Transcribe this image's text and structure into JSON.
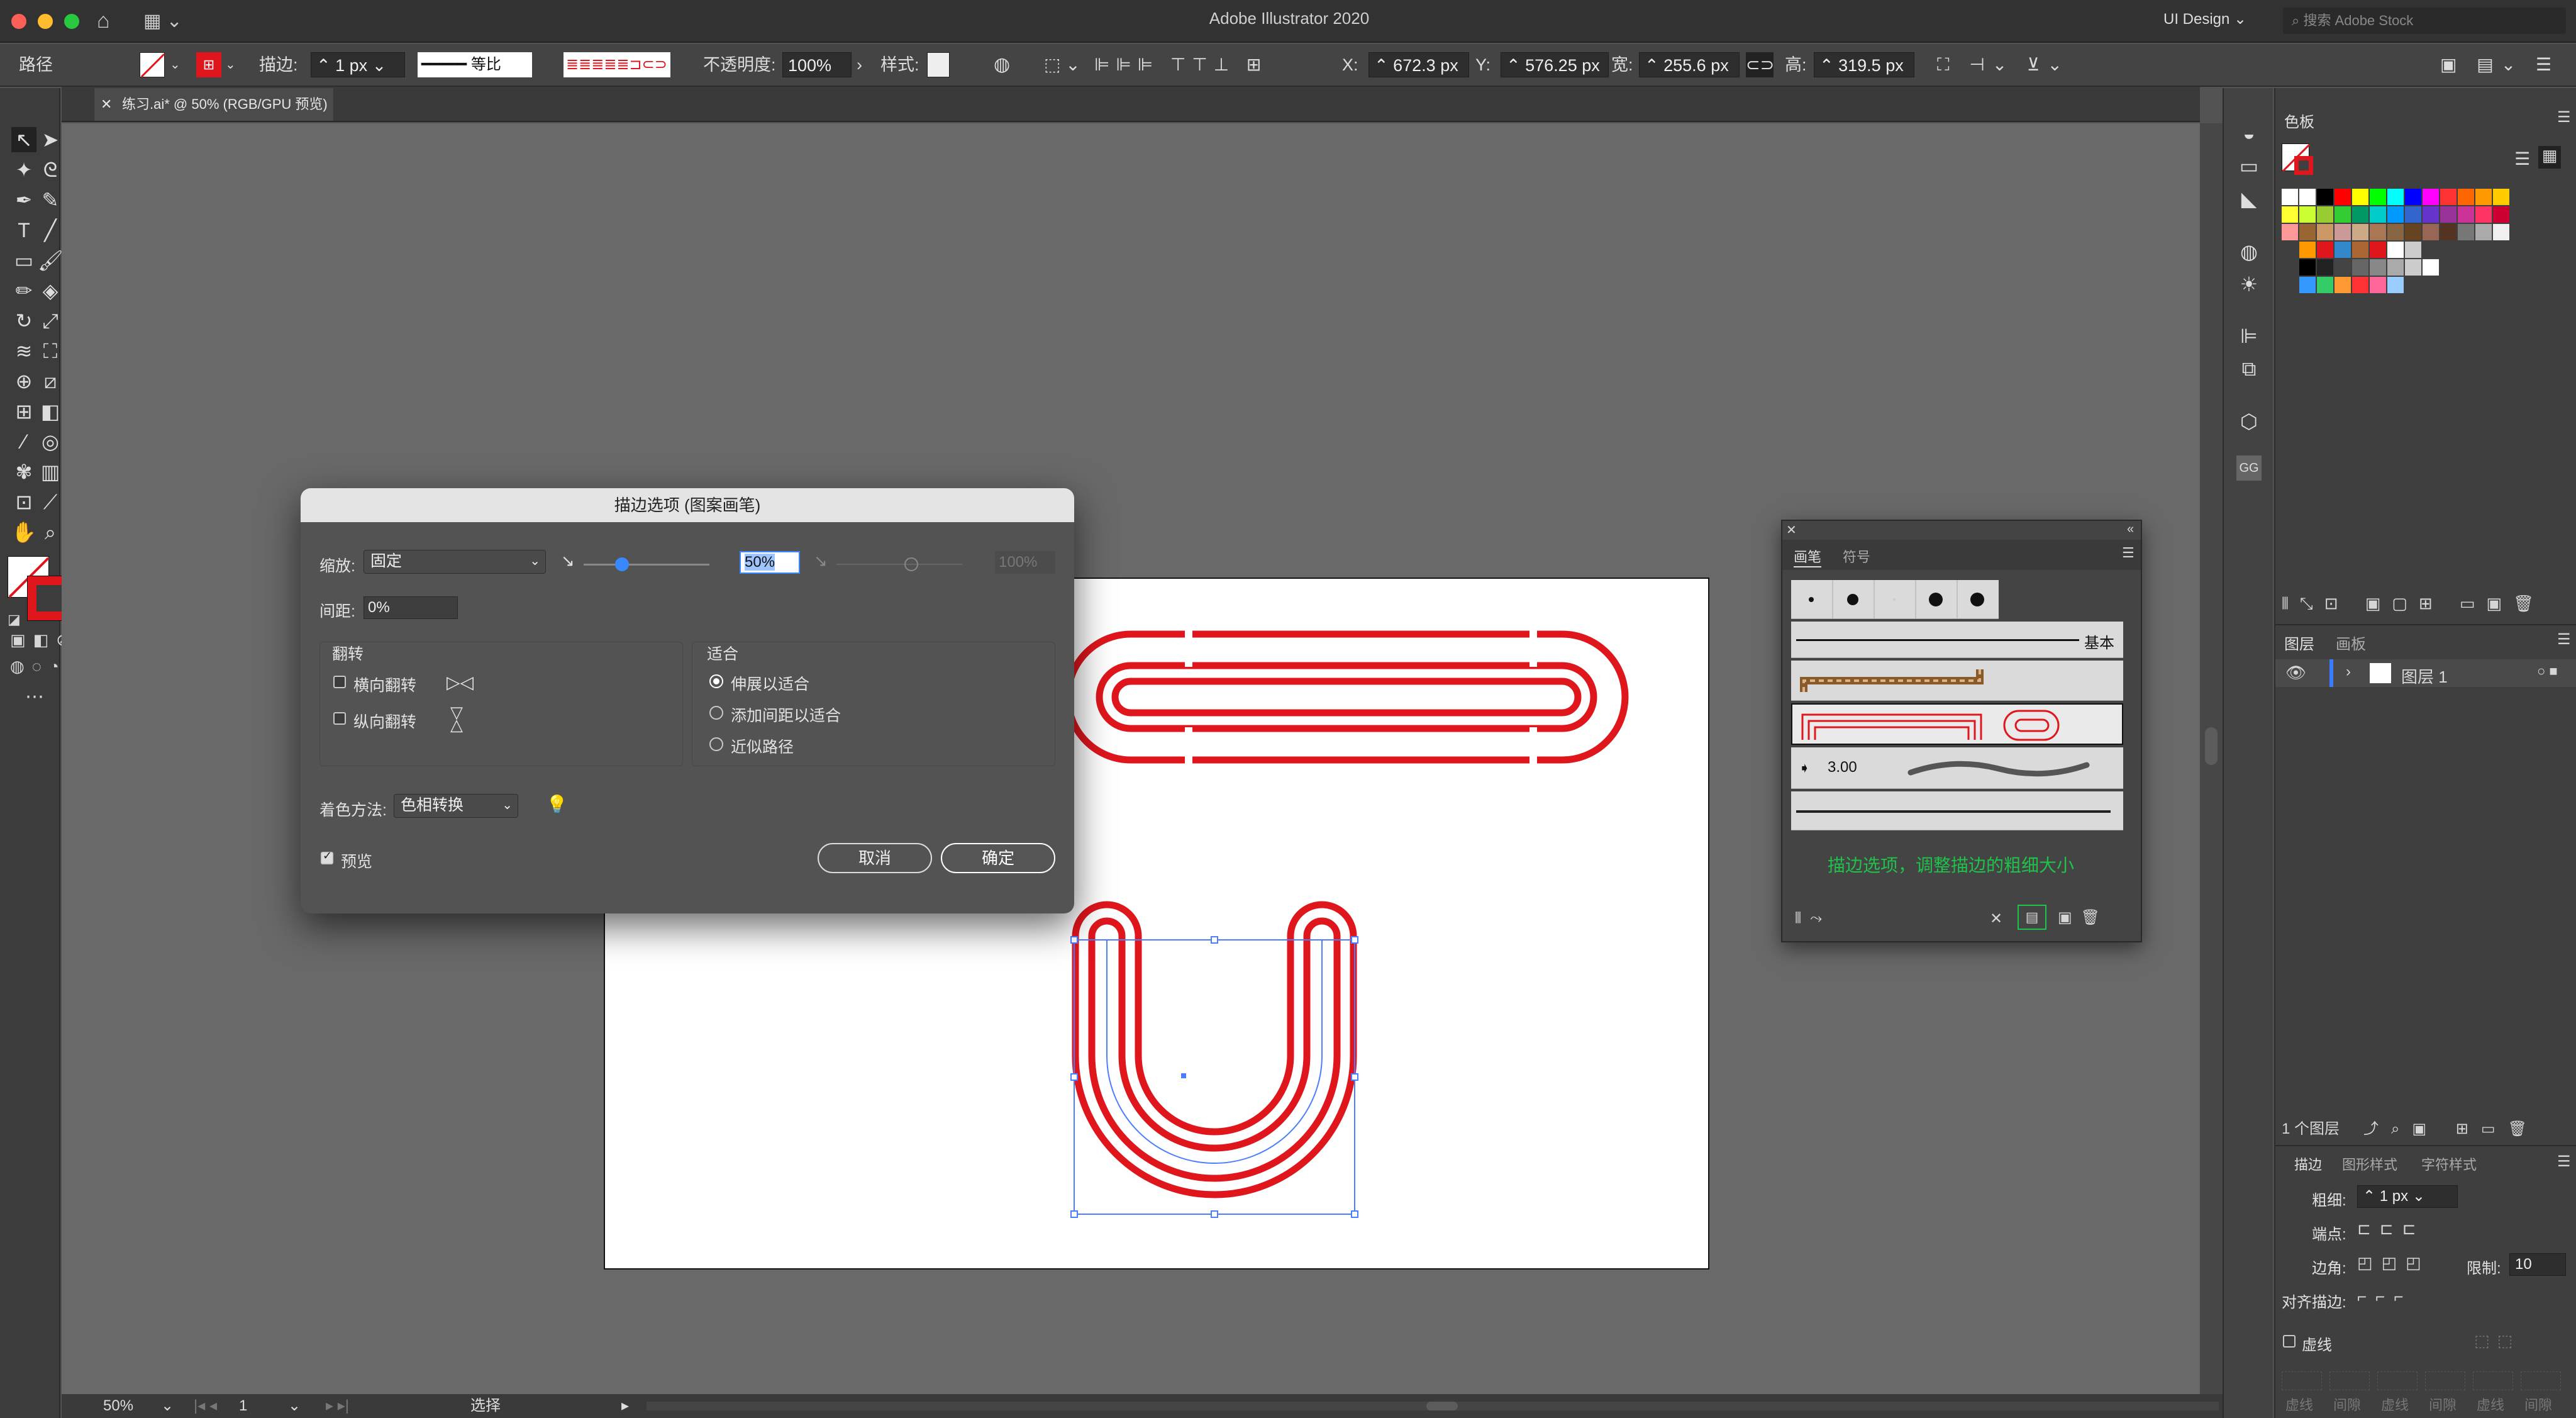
{
  "app": {
    "title": "Adobe Illustrator 2020",
    "workspace": "UI Design",
    "search_placeholder": "搜索 Adobe Stock"
  },
  "control": {
    "object_type": "路径",
    "stroke_label": "描边:",
    "stroke_value": "1 px",
    "profile_label": "等比",
    "opacity_label": "不透明度:",
    "opacity_value": "100%",
    "style_label": "样式:",
    "x_label": "X:",
    "x_value": "672.3 px",
    "y_label": "Y:",
    "y_value": "576.25 px",
    "w_label": "宽:",
    "w_value": "255.6 px",
    "h_label": "高:",
    "h_value": "319.5 px"
  },
  "document_tab": {
    "label": "练习.ai* @ 50% (RGB/GPU 预览)"
  },
  "status": {
    "zoom": "50%",
    "page": "1",
    "tool": "选择"
  },
  "dialog": {
    "title": "描边选项 (图案画笔)",
    "scale_label": "缩放:",
    "scale_mode": "固定",
    "scale_value": "50%",
    "scale_value2": "100%",
    "spacing_label": "间距:",
    "spacing_value": "0%",
    "flip_label": "翻转",
    "flip_h": "横向翻转",
    "flip_v": "纵向翻转",
    "fit_label": "适合",
    "fit_options": [
      "伸展以适合",
      "添加间距以适合",
      "近似路径"
    ],
    "color_label": "着色方法:",
    "color_value": "色相转换",
    "preview_label": "预览",
    "cancel": "取消",
    "ok": "确定"
  },
  "brush_panel": {
    "tab1": "画笔",
    "tab2": "符号",
    "basic_label": "基本",
    "size_value": "3.00",
    "annotation": "描边选项，调整描边的粗细大小"
  },
  "swatches": {
    "title": "色板"
  },
  "layers": {
    "tab1": "图层",
    "tab2": "画板",
    "layer_name": "图层 1",
    "count": "1 个图层"
  },
  "stroke_panel": {
    "tab1": "描边",
    "tab2": "图形样式",
    "tab3": "字符样式",
    "weight_label": "粗细:",
    "weight_value": "1 px",
    "cap_label": "端点:",
    "corner_label": "边角:",
    "limit_label": "限制:",
    "limit_value": "10",
    "align_label": "对齐描边:",
    "dashed_label": "虚线",
    "dash_labels": [
      "虚线",
      "间隙",
      "虚线",
      "间隙",
      "虚线",
      "间隙"
    ]
  },
  "colors": {
    "accent": "#e0161d",
    "selection": "#4a7dff",
    "annotation": "#1fc24a"
  }
}
